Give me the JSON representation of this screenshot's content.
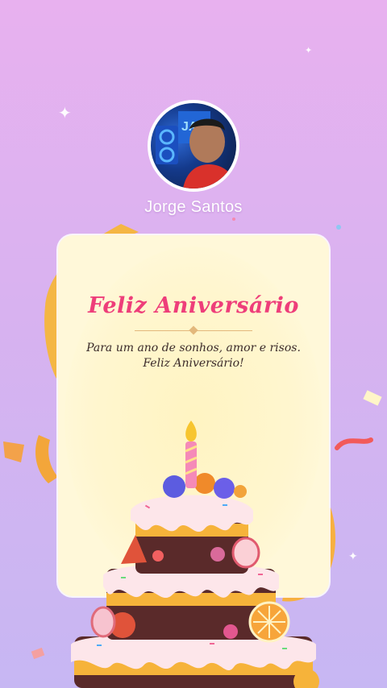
{
  "profile": {
    "name": "Jorge Santos",
    "avatar_icon": "person-photo-icon"
  },
  "card": {
    "title": "Feliz Aniversário",
    "message_line1": "Para um ano de sonhos, amor e risos.",
    "message_line2": "Feliz Aniversário!"
  },
  "colors": {
    "title": "#ee3e7a",
    "background_top": "#e8b1ef",
    "background_bottom": "#c7b7f3",
    "card": "#fff8d9",
    "ribbon": "#f6b63a"
  },
  "decorations": {
    "cake_icon": "birthday-cake-icon",
    "candle_icon": "candle-icon",
    "sparkle_icon": "sparkle-icon",
    "ribbon_icon": "ribbon-icon",
    "confetti_icon": "confetti-icon"
  }
}
